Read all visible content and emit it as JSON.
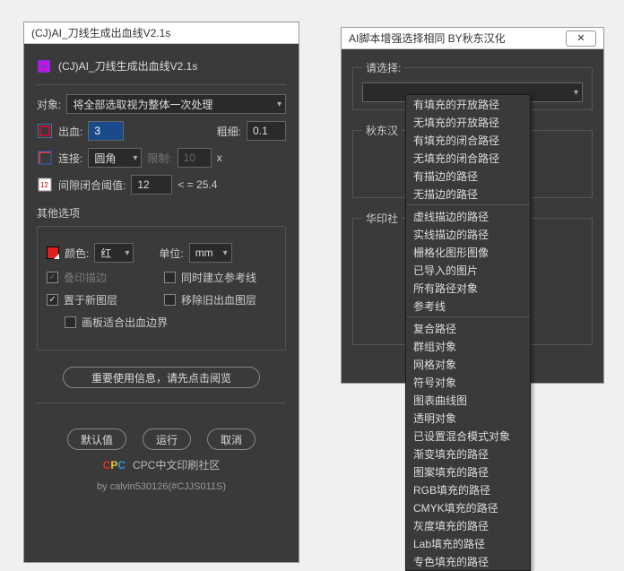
{
  "left": {
    "windowTitle": "(CJ)AI_刀线生成出血线V2.1s",
    "headerTitle": "(CJ)AI_刀线生成出血线V2.1s",
    "objectLabel": "对象:",
    "objectValue": "将全部选取视为整体一次处理",
    "bleedLabel": "出血:",
    "bleedValue": "3",
    "thickLabel": "粗细:",
    "thickValue": "0.1",
    "connectLabel": "连接:",
    "connectValue": "圆角",
    "limitLabel": "限制:",
    "limitValue": "10",
    "limitSuffix": "x",
    "gapLabel": "间隙闭合阈值:",
    "gapValue": "12",
    "gapSuffix": "< = 25.4",
    "otherOptions": "其他选项",
    "colorLabel": "颜色:",
    "colorValue": "红",
    "unitLabel": "单位:",
    "unitValue": "mm",
    "overprintLabel": "叠印描边",
    "guideLabel": "同时建立参考线",
    "newLayerLabel": "置于新图层",
    "removeOldLabel": "移除旧出血图层",
    "clipLabel": "画板适合出血边界",
    "infoBtn": "重要使用信息，请先点击阅览",
    "defaultBtn": "默认值",
    "runBtn": "运行",
    "cancelBtn": "取消",
    "footerText": "CPC中文印刷社区",
    "byline": "by calvin530126(#CJJS011S)"
  },
  "right": {
    "windowTitle": "AI脚本增强选择相同  BY秋东汉化",
    "selectLabel": "请选择:",
    "selectValue": "",
    "group2": "秋东汉",
    "group3": "华印社",
    "options": [
      "有填充的开放路径",
      "无填充的开放路径",
      "有填充的闭合路径",
      "无填充的闭合路径",
      "有描边的路径",
      "无描边的路径",
      "—",
      "虚线描边的路径",
      "实线描边的路径",
      "栅格化图形图像",
      "已导入的图片",
      "所有路径对象",
      "参考线",
      "—",
      "复合路径",
      "群组对象",
      "网格对象",
      "符号对象",
      "图表曲线图",
      "透明对象",
      "已设置混合模式对象",
      "渐变填充的路径",
      "图案填充的路径",
      "RGB填充的路径",
      "CMYK填充的路径",
      "灰度填充的路径",
      "Lab填充的路径",
      "专色填充的路径"
    ]
  }
}
